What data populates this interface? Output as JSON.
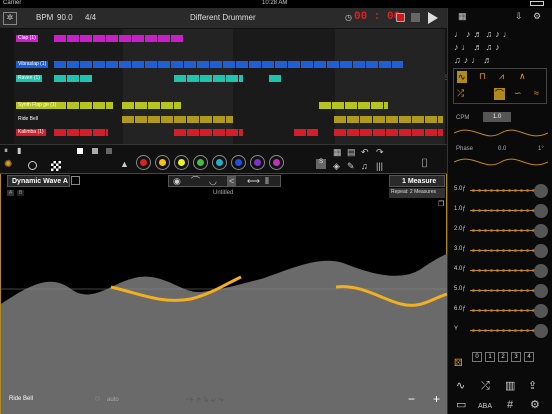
{
  "status": {
    "carrier": "Carrier",
    "time": "10:28 AM"
  },
  "topbar": {
    "bpm_label": "BPM",
    "bpm_value": "90.0",
    "time_sig": "4/4",
    "title": "Different Drummer",
    "timer": "00 : 00"
  },
  "tracks": [
    {
      "label": "Clap (1)",
      "color": "#c91ec9"
    },
    {
      "label": "Vibraslap (1)",
      "color": "#1e5fd6"
    },
    {
      "label": "Raven (1)",
      "color": "#1ec4b0"
    },
    {
      "label": "Synth Flap ge (1)",
      "color": "#b7c41e"
    },
    {
      "label": "Ride Bell",
      "color": "#b09a1e"
    },
    {
      "label": "Kalimba (1)",
      "color": "#d61e2a"
    }
  ],
  "palette": [
    "#e02020",
    "#f2c318",
    "#f0f020",
    "#40c040",
    "#20b0d0",
    "#2050e0",
    "#8030d0",
    "#c030c0"
  ],
  "editor": {
    "wave_name": "Dynamic Wave A",
    "preset": "Untitled",
    "measure": "1 Measure",
    "repeat": "Repeat: 2 Measures",
    "track_name": "Ride Bell",
    "auto_label": "auto",
    "minus": "−",
    "plus": "+",
    "a_label": "A",
    "b_label": "B"
  },
  "right": {
    "cpm_label": "CPM",
    "cpm_value": "1.0",
    "phase_label": "Phase",
    "phase_value": "0.0",
    "phase_unit": "1°",
    "sliders": [
      {
        "label": "5.0",
        "marker": "ƒ"
      },
      {
        "label": "1.0",
        "marker": "ƒ"
      },
      {
        "label": "2.0",
        "marker": "ƒ"
      },
      {
        "label": "3.0",
        "marker": "ƒ"
      },
      {
        "label": "4.0",
        "marker": "ƒ"
      },
      {
        "label": "5.0",
        "marker": "ƒ"
      },
      {
        "label": "6.0",
        "marker": "ƒ"
      },
      {
        "label": "Y",
        "marker": ""
      }
    ],
    "numbers": [
      "0",
      "1",
      "2",
      "3",
      "4"
    ],
    "bottom_aba": "ABA"
  }
}
